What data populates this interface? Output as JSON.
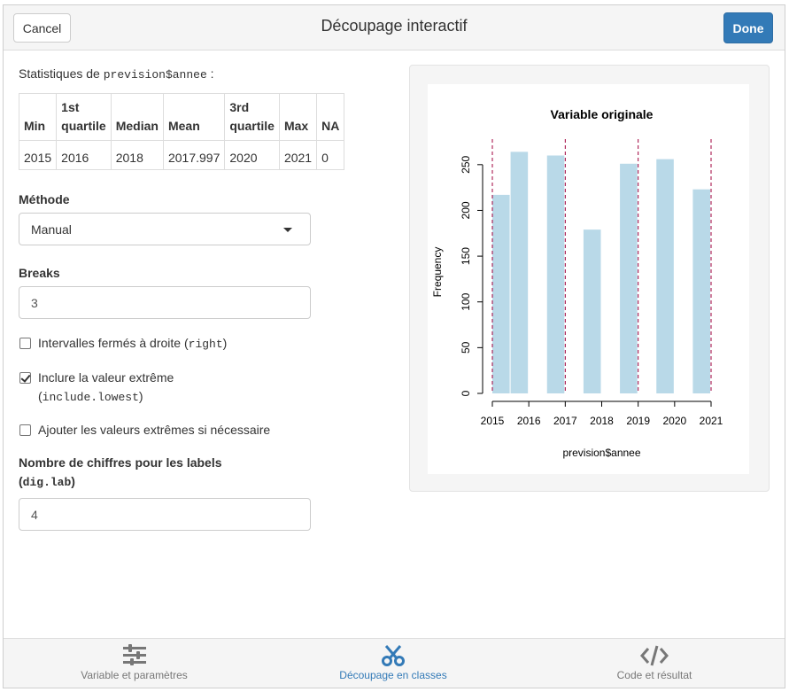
{
  "header": {
    "cancel_label": "Cancel",
    "title": "Découpage interactif",
    "done_label": "Done"
  },
  "stats": {
    "intro_text": "Statistiques de ",
    "variable": "prevision$annee",
    "intro_suffix": " :",
    "columns": [
      "Min",
      "1st quartile",
      "Median",
      "Mean",
      "3rd quartile",
      "Max",
      "NA"
    ],
    "column_lines": [
      [
        "Min"
      ],
      [
        "1st",
        "quartile"
      ],
      [
        "Median"
      ],
      [
        "Mean"
      ],
      [
        "3rd",
        "quartile"
      ],
      [
        "Max"
      ],
      [
        "NA"
      ]
    ],
    "values": [
      "2015",
      "2016",
      "2018",
      "2017.997",
      "2020",
      "2021",
      "0"
    ]
  },
  "method": {
    "label": "Méthode",
    "value": "Manual"
  },
  "breaks": {
    "label": "Breaks",
    "value": "3"
  },
  "options": {
    "right": {
      "text": "Intervalles fermés à droite ",
      "code": "right",
      "checked": false
    },
    "include_lowest": {
      "text": "Inclure la valeur extrême",
      "code": "include.lowest",
      "checked": true
    },
    "extend": {
      "text": "Ajouter les valeurs extrêmes si nécessaire",
      "checked": false
    }
  },
  "digits": {
    "label": "Nombre de chiffres pour les labels",
    "code": "dig.lab",
    "value": "4"
  },
  "chart_data": {
    "type": "bar",
    "title": "Variable originale",
    "xlabel": "prevision$annee",
    "ylabel": "Frequency",
    "bars": [
      {
        "from": 2015.0,
        "to": 2015.5,
        "value": 217
      },
      {
        "from": 2015.5,
        "to": 2016.0,
        "value": 264
      },
      {
        "from": 2016.5,
        "to": 2017.0,
        "value": 260
      },
      {
        "from": 2017.5,
        "to": 2018.0,
        "value": 179
      },
      {
        "from": 2018.5,
        "to": 2019.0,
        "value": 251
      },
      {
        "from": 2019.5,
        "to": 2020.0,
        "value": 256
      },
      {
        "from": 2020.5,
        "to": 2021.0,
        "value": 223
      }
    ],
    "x_ticks": [
      2015,
      2016,
      2017,
      2018,
      2019,
      2020,
      2021
    ],
    "y_ticks": [
      0,
      50,
      100,
      150,
      200,
      250
    ],
    "xlim": [
      2015,
      2021
    ],
    "ylim": [
      0,
      275
    ],
    "break_lines": [
      2015,
      2017,
      2019,
      2021
    ],
    "bar_color": "#b9d9e8",
    "break_color": "#a0003c"
  },
  "footer": {
    "tabs": [
      {
        "label": "Variable et paramètres",
        "icon": "sliders-icon",
        "active": false
      },
      {
        "label": "Découpage en classes",
        "icon": "scissors-icon",
        "active": true
      },
      {
        "label": "Code et résultat",
        "icon": "code-icon",
        "active": false
      }
    ],
    "active_color": "#337ab7"
  }
}
